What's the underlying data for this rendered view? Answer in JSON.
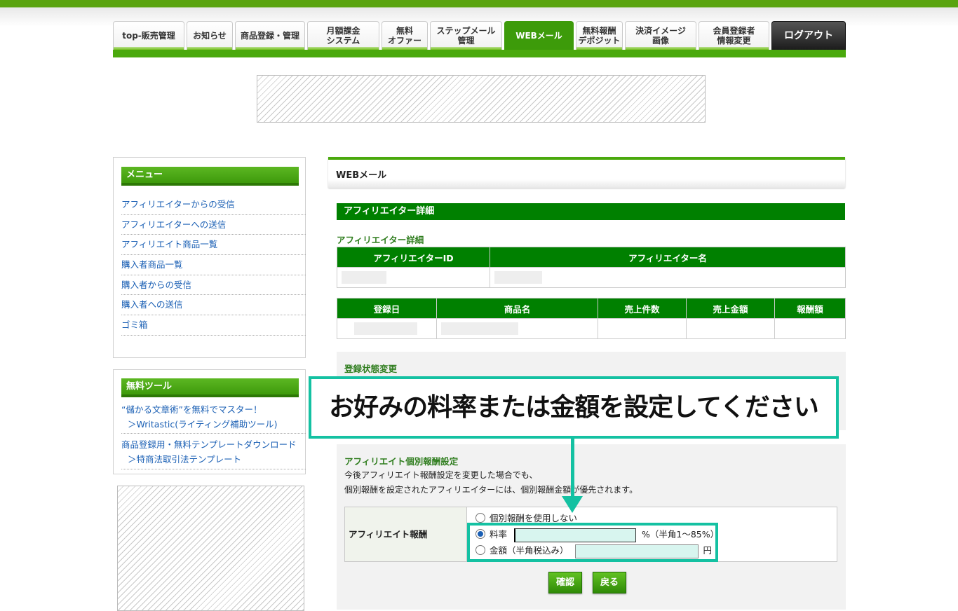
{
  "nav": {
    "tabs": [
      {
        "label": "top-販売管理"
      },
      {
        "label": "お知らせ"
      },
      {
        "label": "商品登録・管理"
      },
      {
        "label": "月額課金\nシステム"
      },
      {
        "label": "無料\nオファー"
      },
      {
        "label": "ステップメール\n管理"
      },
      {
        "label": "WEBメール",
        "active": true
      },
      {
        "label": "無料報酬\nデポジット"
      },
      {
        "label": "決済イメージ\n画像"
      },
      {
        "label": "会員登録者\n情報変更"
      },
      {
        "label": "ログアウト"
      }
    ]
  },
  "sidebar": {
    "menu_title": "メニュー",
    "menu_items": [
      {
        "label": "アフィリエイターからの受信"
      },
      {
        "label": "アフィリエイターへの送信"
      },
      {
        "label": "アフィリエイト商品一覧"
      },
      {
        "label": "購入者商品一覧"
      },
      {
        "label": "購入者からの受信"
      },
      {
        "label": "購入者への送信"
      },
      {
        "label": "ゴミ箱"
      }
    ],
    "tools_title": "無料ツール",
    "tools": [
      {
        "line1": "“儲かる文章術”を無料でマスター！",
        "line2": "＞Writastic(ライティング補助ツール)"
      },
      {
        "line1": "商品登録用・無料テンプレートダウンロード",
        "line2": "＞特商法取引法テンプレート"
      }
    ]
  },
  "main": {
    "page_title": "WEBメール",
    "section_bar": "アフィリエイター詳細",
    "detail_heading": "アフィリエイター詳細",
    "affiliate_table": {
      "headers": [
        "アフィリエイターID",
        "アフィリエイター名"
      ]
    },
    "sales_table": {
      "headers": [
        "登録日",
        "商品名",
        "売上件数",
        "売上金額",
        "報酬額"
      ]
    },
    "status_heading": "登録状態変更",
    "reward_heading": "アフィリエイト個別報酬設定",
    "note_line1": "今後アフィリエイト報酬設定を変更した場合でも、",
    "note_line2": "個別報酬を設定されたアフィリエイターには、個別報酬金額が優先されます。",
    "reward_label": "アフィリエイト報酬",
    "options": {
      "none": "個別報酬を使用しない",
      "rate": "料率",
      "rate_suffix": "%（半角1〜85%）",
      "amount": "金額（半角税込み）",
      "amount_suffix": "円"
    },
    "rate_value": "",
    "amount_value": "",
    "selected_option": "rate",
    "buttons": {
      "confirm": "確認",
      "back": "戻る"
    }
  },
  "callout": {
    "text": "お好みの料率または金額を設定してください"
  },
  "colors": {
    "brand_green": "#008000",
    "accent_teal": "#14c1a2",
    "tab_active": "#3d9b0a"
  }
}
